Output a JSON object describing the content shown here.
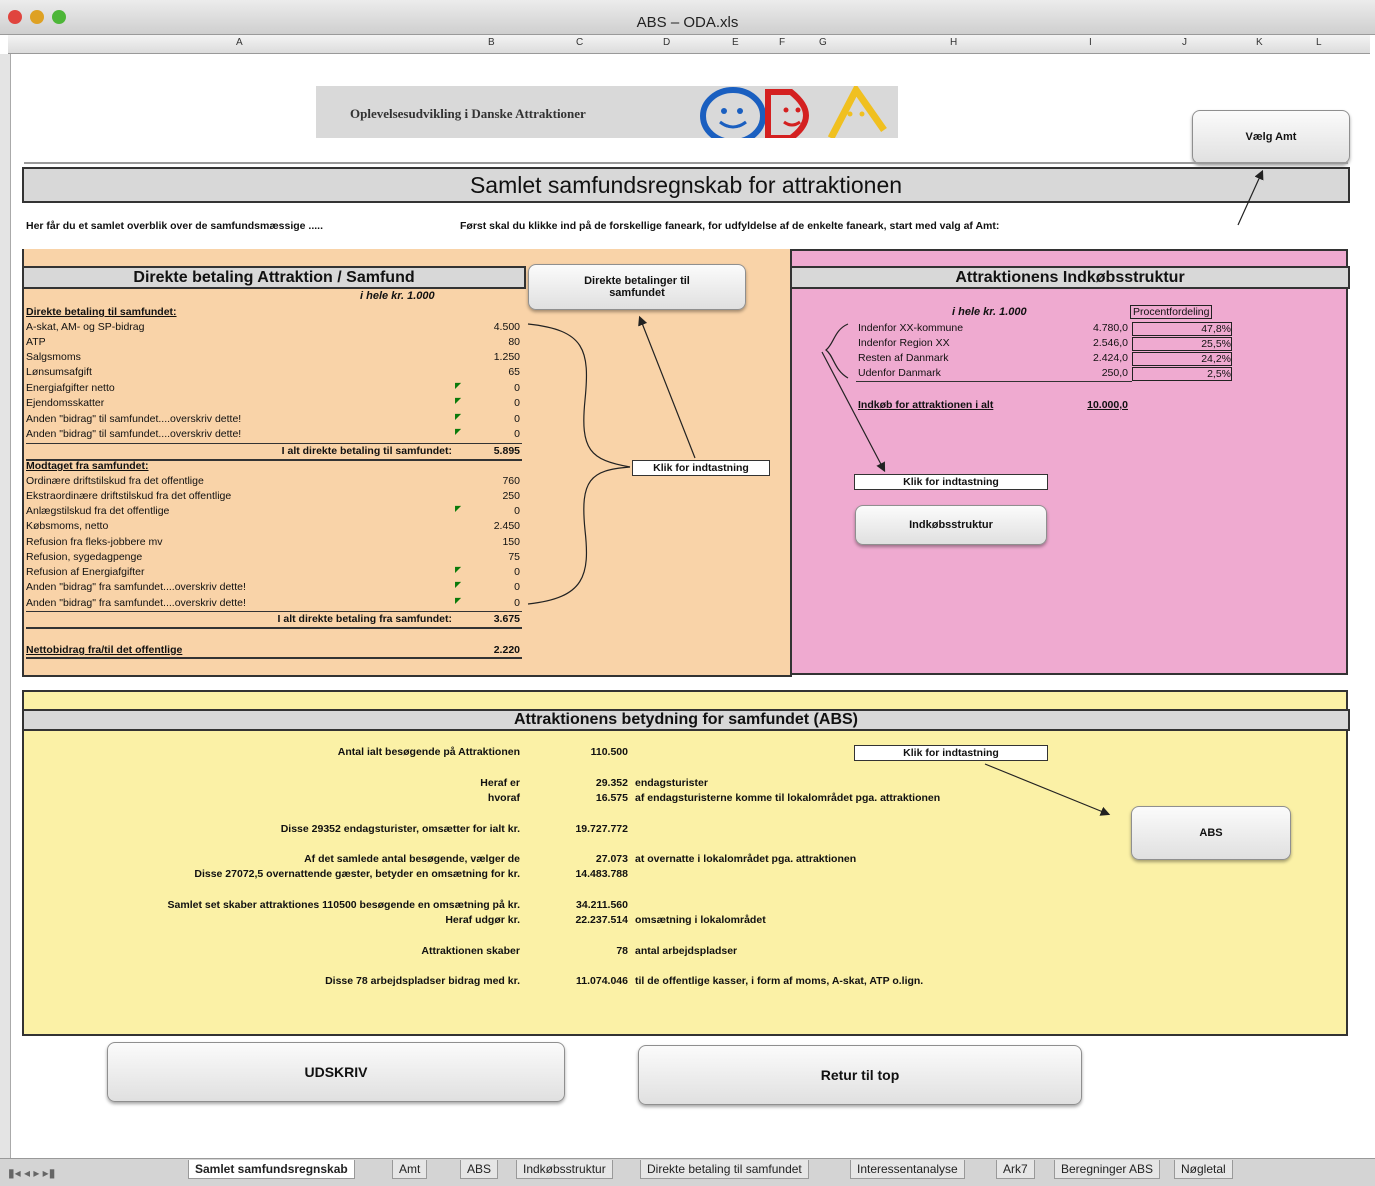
{
  "window": {
    "title": "ABS – ODA.xls"
  },
  "columns": [
    "A",
    "B",
    "C",
    "D",
    "E",
    "F",
    "G",
    "H",
    "I",
    "J",
    "K",
    "L"
  ],
  "logo": {
    "text": "Oplevelsesudvikling i Danske Attraktioner",
    "letters": "ODA"
  },
  "buttons": {
    "vaelg_amt": "Vælg Amt",
    "direkte": "Direkte betalinger til samfundet",
    "indkob": "Indkøbsstruktur",
    "abs": "ABS",
    "udskriv": "UDSKRIV",
    "retur": "Retur til top"
  },
  "main_title": "Samlet samfundsregnskab for attraktionen",
  "intro": {
    "left": "Her får du et samlet overblik over de samfundsmæssige .....",
    "right": "Først skal du klikke ind på de forskellige faneark, for udfyldelse af de enkelte faneark, start med valg af Amt:"
  },
  "left_panel": {
    "title": "Direkte betaling Attraktion / Samfund",
    "unit": "i hele kr. 1.000",
    "head1": "Direkte betaling til samfundet:",
    "rows1": [
      {
        "label": "A-skat, AM- og SP-bidrag",
        "value": "4.500",
        "tri": false
      },
      {
        "label": "ATP",
        "value": "80",
        "tri": false
      },
      {
        "label": "Salgsmoms",
        "value": "1.250",
        "tri": false
      },
      {
        "label": "Lønsumsafgift",
        "value": "65",
        "tri": false
      },
      {
        "label": "Energiafgifter netto",
        "value": "0",
        "tri": true
      },
      {
        "label": "Ejendomsskatter",
        "value": "0",
        "tri": true
      },
      {
        "label": "Anden \"bidrag\" til samfundet....overskriv dette!",
        "value": "0",
        "tri": true
      },
      {
        "label": "Anden \"bidrag\" til samfundet....overskriv dette!",
        "value": "0",
        "tri": true
      }
    ],
    "total1_label": "I alt direkte betaling til samfundet:",
    "total1_value": "5.895",
    "head2": "Modtaget fra samfundet:",
    "rows2": [
      {
        "label": "Ordinære driftstilskud fra det offentlige",
        "value": "760",
        "tri": false
      },
      {
        "label": "Ekstraordinære driftstilskud fra det offentlige",
        "value": "250",
        "tri": false
      },
      {
        "label": "Anlægstilskud fra det offentlige",
        "value": "0",
        "tri": true
      },
      {
        "label": "Købsmoms, netto",
        "value": "2.450",
        "tri": false
      },
      {
        "label": "Refusion fra fleks-jobbere mv",
        "value": "150",
        "tri": false
      },
      {
        "label": "Refusion, sygedagpenge",
        "value": "75",
        "tri": false
      },
      {
        "label": "Refusion af Energiafgifter",
        "value": "0",
        "tri": true
      },
      {
        "label": "Anden \"bidrag\" fra samfundet....overskriv dette!",
        "value": "0",
        "tri": true
      },
      {
        "label": "Anden \"bidrag\" fra samfundet....overskriv dette!",
        "value": "0",
        "tri": true
      }
    ],
    "total2_label": "I alt direkte betaling fra samfundet:",
    "total2_value": "3.675",
    "net_label": "Nettobidrag fra/til det offentlige",
    "net_value": "2.220",
    "entry": "Klik for indtastning"
  },
  "right_panel": {
    "title": "Attraktionens Indkøbsstruktur",
    "unit": "i hele kr. 1.000",
    "pct_header": "Procentfordeling",
    "rows": [
      {
        "label": "Indenfor XX-kommune",
        "value": "4.780,0",
        "pct": "47,8%"
      },
      {
        "label": "Indenfor Region XX",
        "value": "2.546,0",
        "pct": "25,5%"
      },
      {
        "label": "Resten af Danmark",
        "value": "2.424,0",
        "pct": "24,2%"
      },
      {
        "label": "Udenfor Danmark",
        "value": "250,0",
        "pct": "2,5%"
      }
    ],
    "total_label": "Indkøb for attraktionen i alt",
    "total_value": "10.000,0",
    "entry": "Klik for indtastning"
  },
  "abs_panel": {
    "title": "Attraktionens betydning for samfundet (ABS)",
    "entry": "Klik for indtastning",
    "rows": [
      {
        "label": "Antal ialt besøgende på Attraktionen",
        "value": "110.500",
        "text": ""
      },
      {
        "label": "Heraf er",
        "value": "29.352",
        "text": "endagsturister"
      },
      {
        "label": "hvoraf",
        "value": "16.575",
        "text": "af endagsturisterne komme til lokalområdet pga. attraktionen"
      },
      {
        "label": "Disse 29352 endagsturister, omsætter for ialt kr.",
        "value": "19.727.772",
        "text": ""
      },
      {
        "label": "Af det samlede antal besøgende, vælger de",
        "value": "27.073",
        "text": "at overnatte i lokalområdet pga. attraktionen"
      },
      {
        "label": "Disse 27072,5 overnattende gæster, betyder en omsætning for kr.",
        "value": "14.483.788",
        "text": ""
      },
      {
        "label": "Samlet set skaber attraktiones 110500 besøgende en omsætning på kr.",
        "value": "34.211.560",
        "text": ""
      },
      {
        "label": "Heraf udgør kr.",
        "value": "22.237.514",
        "text": "omsætning i lokalområdet"
      },
      {
        "label": "Attraktionen skaber",
        "value": "78",
        "text": "antal arbejdspladser"
      },
      {
        "label": "Disse 78 arbejdspladser bidrag med kr.",
        "value": "11.074.046",
        "text": "til de offentlige kasser, i form af moms, A-skat, ATP o.lign."
      }
    ]
  },
  "sheet_tabs": [
    "Samlet samfundsregnskab",
    "Amt",
    "ABS",
    "Indkøbsstruktur",
    "Direkte betaling til samfundet",
    "Interessentanalyse",
    "Ark7",
    "Beregninger ABS",
    "Nøgletal"
  ],
  "colors": {
    "peach": "#f9d3a8",
    "pink": "#efaad0",
    "yellow": "#fbf1a6",
    "grey_banner": "#d8d8d8"
  }
}
